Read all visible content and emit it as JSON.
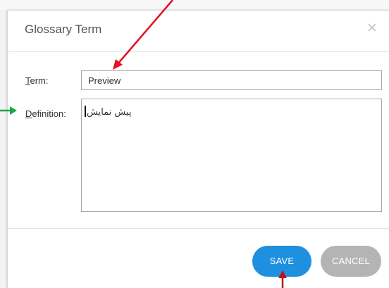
{
  "dialog": {
    "title": "Glossary Term",
    "close_icon": "close-icon"
  },
  "form": {
    "term_label_hotkey": "T",
    "term_label_rest": "erm:",
    "term_value": "Preview",
    "definition_label_hotkey": "D",
    "definition_label_rest": "efinition:",
    "definition_value": "پیش نمایش"
  },
  "buttons": {
    "save_label": "SAVE",
    "cancel_label": "CANCEL"
  },
  "colors": {
    "save": "#1f8fe0",
    "cancel": "#b4b4b4",
    "annotation_red": "#e0141e",
    "annotation_green": "#1aa64a"
  }
}
